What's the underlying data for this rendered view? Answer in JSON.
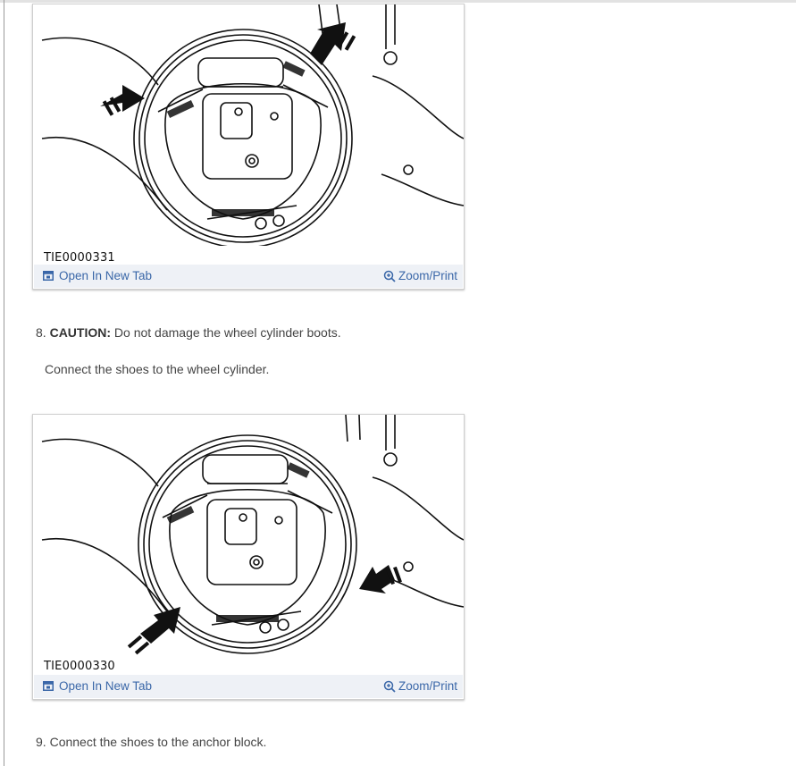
{
  "figures": [
    {
      "code": "TIE0000331",
      "open_label": "Open In New Tab",
      "zoom_label": "Zoom/Print",
      "illustration": "rear drum brake assembly, arrows at wheel cylinder"
    },
    {
      "code": "TIE0000330",
      "open_label": "Open In New Tab",
      "zoom_label": "Zoom/Print",
      "illustration": "rear drum brake assembly, arrows at anchor block"
    }
  ],
  "steps": {
    "step8": {
      "number": "8.",
      "caution_label": "CAUTION:",
      "caution_text": " Do not damage the wheel cylinder boots.",
      "instruction": "Connect the shoes to the wheel cylinder."
    },
    "step9": {
      "number": "9.",
      "text": " Connect the shoes to the anchor block."
    }
  },
  "colors": {
    "link": "#3a67a8",
    "bar": "#eef1f6",
    "text": "#444444"
  },
  "icons": {
    "open": "open-tab-icon",
    "zoom": "zoom-in-icon"
  }
}
